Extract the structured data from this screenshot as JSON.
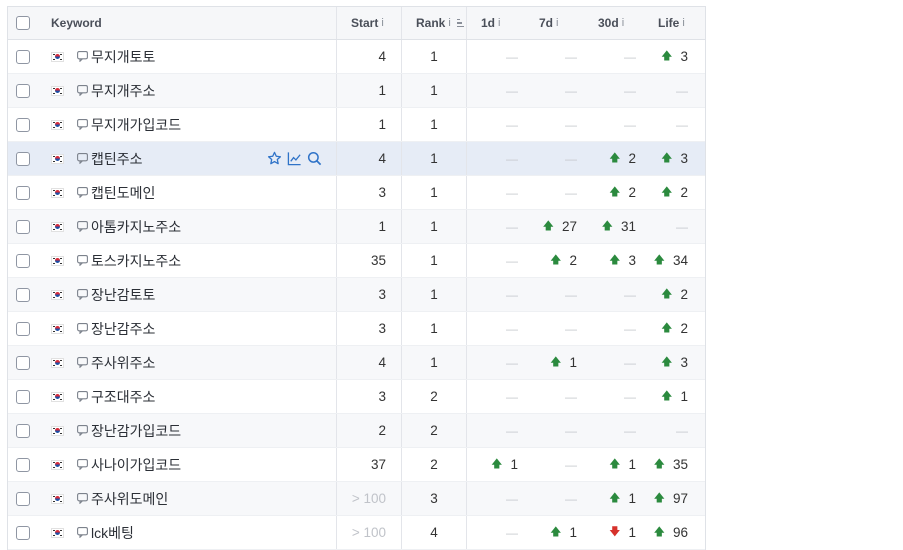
{
  "headers": {
    "keyword": "Keyword",
    "start": "Start",
    "rank": "Rank",
    "d1": "1d",
    "d7": "7d",
    "d30": "30d",
    "life": "Life",
    "info_icon": "i"
  },
  "colors": {
    "up": "#2b8a3e",
    "down": "#d6312b",
    "highlight": "#e6ecf6",
    "action": "#2f73c8"
  },
  "rows": [
    {
      "keyword": "무지개토토",
      "start": "4",
      "rank": "1",
      "d1": "—",
      "d7": "—",
      "d30": "—",
      "life": "3",
      "life_dir": "up"
    },
    {
      "keyword": "무지개주소",
      "start": "1",
      "rank": "1",
      "d1": "—",
      "d7": "—",
      "d30": "—",
      "life": "—"
    },
    {
      "keyword": "무지개가입코드",
      "start": "1",
      "rank": "1",
      "d1": "—",
      "d7": "—",
      "d30": "—",
      "life": "—"
    },
    {
      "keyword": "캡틴주소",
      "start": "4",
      "rank": "1",
      "d1": "—",
      "d7": "—",
      "d30": "2",
      "d30_dir": "up",
      "life": "3",
      "life_dir": "up",
      "highlighted": true
    },
    {
      "keyword": "캡틴도메인",
      "start": "3",
      "rank": "1",
      "d1": "—",
      "d7": "—",
      "d30": "2",
      "d30_dir": "up",
      "life": "2",
      "life_dir": "up"
    },
    {
      "keyword": "아톰카지노주소",
      "start": "1",
      "rank": "1",
      "d1": "—",
      "d7": "27",
      "d7_dir": "up",
      "d30": "31",
      "d30_dir": "up",
      "life": "—"
    },
    {
      "keyword": "토스카지노주소",
      "start": "35",
      "rank": "1",
      "d1": "—",
      "d7": "2",
      "d7_dir": "up",
      "d30": "3",
      "d30_dir": "up",
      "life": "34",
      "life_dir": "up"
    },
    {
      "keyword": "장난감토토",
      "start": "3",
      "rank": "1",
      "d1": "—",
      "d7": "—",
      "d30": "—",
      "life": "2",
      "life_dir": "up"
    },
    {
      "keyword": "장난감주소",
      "start": "3",
      "rank": "1",
      "d1": "—",
      "d7": "—",
      "d30": "—",
      "life": "2",
      "life_dir": "up"
    },
    {
      "keyword": "주사위주소",
      "start": "4",
      "rank": "1",
      "d1": "—",
      "d7": "1",
      "d7_dir": "up",
      "d30": "—",
      "life": "3",
      "life_dir": "up"
    },
    {
      "keyword": "구조대주소",
      "start": "3",
      "rank": "2",
      "d1": "—",
      "d7": "—",
      "d30": "—",
      "life": "1",
      "life_dir": "up"
    },
    {
      "keyword": "장난감가입코드",
      "start": "2",
      "rank": "2",
      "d1": "—",
      "d7": "—",
      "d30": "—",
      "life": "—"
    },
    {
      "keyword": "사나이가입코드",
      "start": "37",
      "rank": "2",
      "d1": "1",
      "d1_dir": "up",
      "d7": "—",
      "d30": "1",
      "d30_dir": "up",
      "life": "35",
      "life_dir": "up"
    },
    {
      "keyword": "주사위도메인",
      "start": "> 100",
      "start_muted": true,
      "rank": "3",
      "d1": "—",
      "d7": "—",
      "d30": "1",
      "d30_dir": "up",
      "life": "97",
      "life_dir": "up"
    },
    {
      "keyword": "lck베팅",
      "start": "> 100",
      "start_muted": true,
      "rank": "4",
      "d1": "—",
      "d7": "1",
      "d7_dir": "up",
      "d30": "1",
      "d30_dir": "down",
      "life": "96",
      "life_dir": "up"
    }
  ]
}
